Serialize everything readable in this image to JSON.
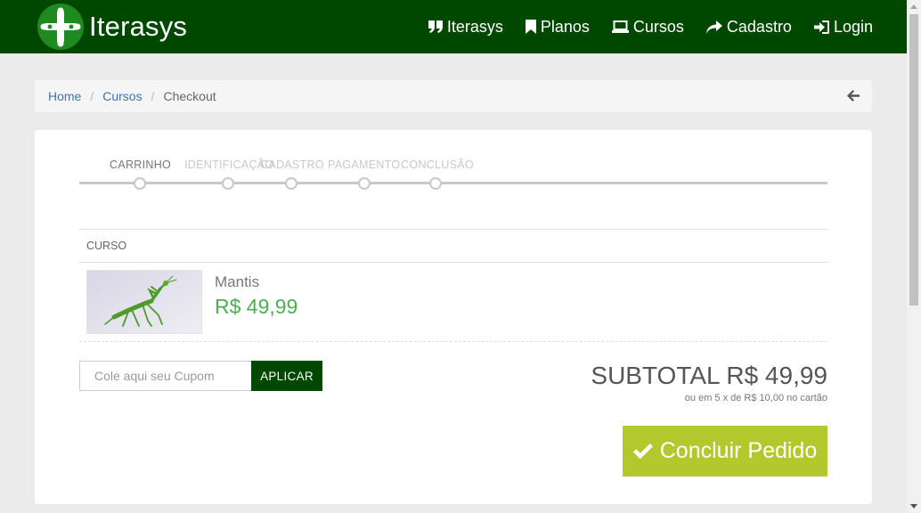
{
  "navbar": {
    "brand": "Iterasys",
    "logo_icon": "plus-dots-logo-icon",
    "items": [
      {
        "label": "Iterasys",
        "icon": "quote-icon"
      },
      {
        "label": "Planos",
        "icon": "bookmark-icon"
      },
      {
        "label": "Cursos",
        "icon": "laptop-icon"
      },
      {
        "label": "Cadastro",
        "icon": "share-icon"
      },
      {
        "label": "Login",
        "icon": "sign-in-icon"
      }
    ],
    "colors": {
      "background": "#004800",
      "text": "#ffffff"
    }
  },
  "breadcrumb": {
    "items": [
      "Home",
      "Cursos",
      "Checkout"
    ],
    "separator": "/",
    "back_icon": "arrow-left-icon"
  },
  "steps": {
    "items": [
      "CARRINHO",
      "IDENTIFICAÇÃO",
      "CADASTRO",
      "PAGAMENTO",
      "CONCLUSÃO"
    ],
    "active_index": 0
  },
  "cart": {
    "column_header": "CURSO",
    "items": [
      {
        "name": "Mantis",
        "price": "R$ 49,99",
        "image": "mantis-image"
      }
    ]
  },
  "coupon": {
    "placeholder": "Cole aqui seu Cupom",
    "button_label": "APLICAR"
  },
  "summary": {
    "subtotal": "SUBTOTAL R$ 49,99",
    "installments": "ou em 5 x de R$ 10,00 no cartão",
    "finish_label": "Concluir Pedido",
    "finish_icon": "check-icon"
  },
  "colors": {
    "brand": "#004800",
    "price": "#4caf50",
    "cta": "#b3c82d",
    "link": "#3a77b0"
  }
}
